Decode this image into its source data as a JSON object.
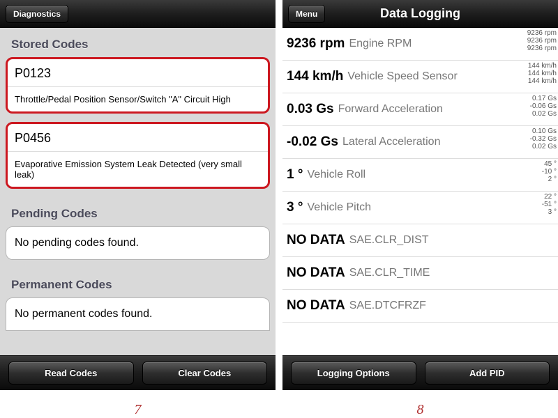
{
  "left": {
    "nav_back": "Diagnostics",
    "sections": {
      "stored_header": "Stored Codes",
      "pending_header": "Pending Codes",
      "permanent_header": "Permanent Codes"
    },
    "codes": [
      {
        "code": "P0123",
        "desc": "Throttle/Pedal Position Sensor/Switch \"A\" Circuit High"
      },
      {
        "code": "P0456",
        "desc": "Evaporative Emission System Leak Detected (very small leak)"
      }
    ],
    "pending_msg": "No pending codes found.",
    "permanent_msg": "No permanent codes found.",
    "btn_read": "Read Codes",
    "btn_clear": "Clear Codes",
    "caption": "7"
  },
  "right": {
    "nav_back": "Menu",
    "title": "Data Logging",
    "rows": [
      {
        "value": "9236 rpm",
        "label": "Engine RPM",
        "history": [
          "9236 rpm",
          "9236 rpm",
          "9236 rpm"
        ]
      },
      {
        "value": "144 km/h",
        "label": "Vehicle Speed Sensor",
        "history": [
          "144 km/h",
          "144 km/h",
          "144 km/h"
        ]
      },
      {
        "value": "0.03 Gs",
        "label": "Forward Acceleration",
        "history": [
          "0.17 Gs",
          "-0.06 Gs",
          "0.02 Gs"
        ]
      },
      {
        "value": "-0.02 Gs",
        "label": "Lateral Acceleration",
        "history": [
          "0.10 Gs",
          "-0.32 Gs",
          "0.02 Gs"
        ]
      },
      {
        "value": "1 °",
        "label": "Vehicle Roll",
        "history": [
          "45 °",
          "-10 °",
          "2 °"
        ]
      },
      {
        "value": "3 °",
        "label": "Vehicle Pitch",
        "history": [
          "22 °",
          "-51 °",
          "3 °"
        ]
      },
      {
        "value": "NO DATA",
        "label": "SAE.CLR_DIST",
        "history": []
      },
      {
        "value": "NO DATA",
        "label": "SAE.CLR_TIME",
        "history": []
      },
      {
        "value": "NO DATA",
        "label": "SAE.DTCFRZF",
        "history": []
      }
    ],
    "btn_logopt": "Logging Options",
    "btn_addpid": "Add PID",
    "caption": "8"
  }
}
